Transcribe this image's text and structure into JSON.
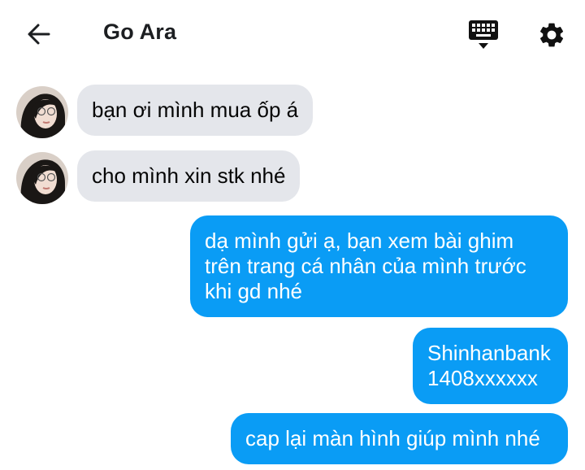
{
  "header": {
    "title": "Go Ara",
    "back_icon": "arrow-left-icon",
    "keyboard_icon": "keyboard-icon",
    "settings_icon": "gear-icon"
  },
  "colors": {
    "incoming_bubble": "#e4e6eb",
    "outgoing_bubble": "#0a9cf5",
    "text_dark": "#050505",
    "text_light": "#ffffff"
  },
  "messages": [
    {
      "direction": "incoming",
      "lines": [
        "bạn ơi mình mua ốp á"
      ]
    },
    {
      "direction": "incoming",
      "lines": [
        "cho mình xin stk nhé"
      ]
    },
    {
      "direction": "outgoing",
      "lines": [
        "dạ mình gửi ạ, bạn xem bài ghim",
        "trên trang cá nhân của mình trước",
        "khi gd nhé"
      ]
    },
    {
      "direction": "outgoing",
      "lines": [
        "Shinhanbank",
        "1408xxxxxx"
      ]
    },
    {
      "direction": "outgoing",
      "lines": [
        "cap lại màn hình giúp mình nhé"
      ]
    }
  ]
}
